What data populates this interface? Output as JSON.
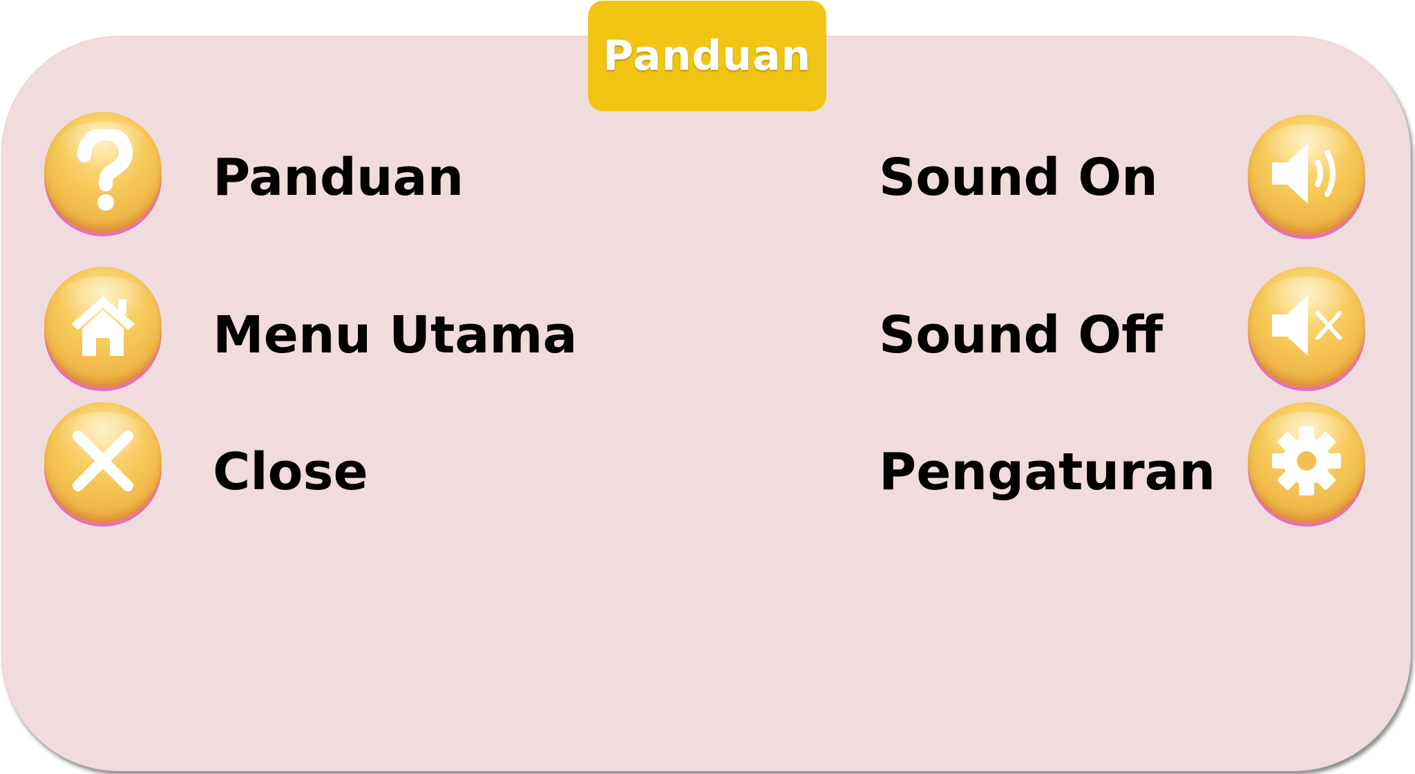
{
  "header": {
    "title": "Panduan"
  },
  "items": {
    "panduan": {
      "label": "Panduan",
      "icon": "question-icon"
    },
    "menu_utama": {
      "label": "Menu Utama",
      "icon": "home-icon"
    },
    "close": {
      "label": "Close",
      "icon": "close-icon"
    },
    "sound_on": {
      "label": "Sound On",
      "icon": "speaker-on-icon"
    },
    "sound_off": {
      "label": "Sound Off",
      "icon": "speaker-mute-icon"
    },
    "pengaturan": {
      "label": "Pengaturan",
      "icon": "gear-icon"
    }
  },
  "colors": {
    "panel": "#f1dcdd",
    "title_tab": "#f0c514",
    "button": "#f5c757",
    "button_shadow": "#e36ccf",
    "text": "#000000"
  }
}
